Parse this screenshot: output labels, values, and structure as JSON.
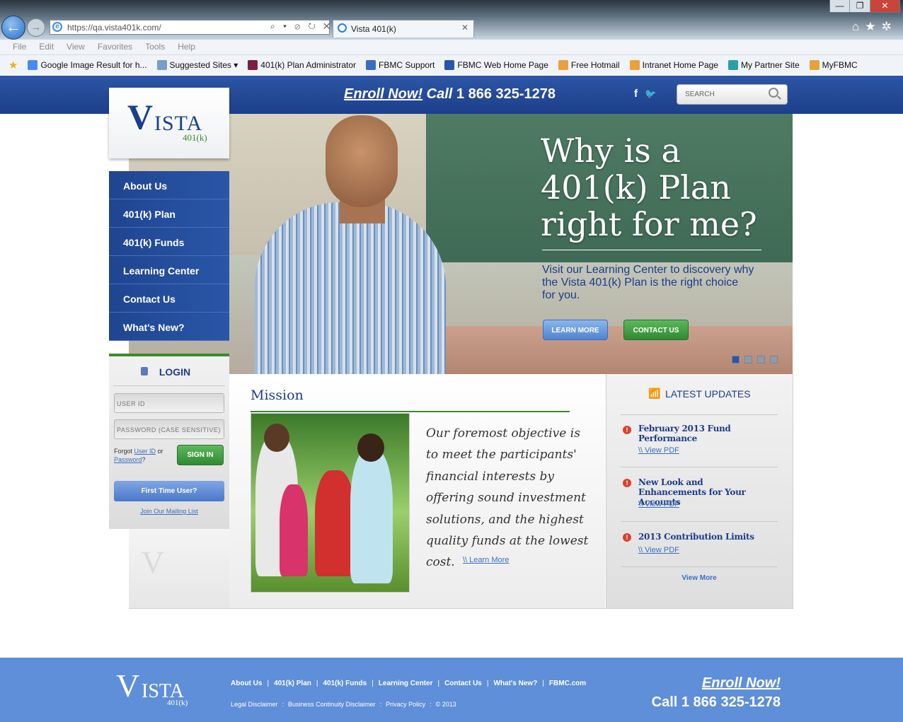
{
  "browser": {
    "url": "https://qa.vista401k.com/",
    "tab_title": "Vista 401(k)",
    "tab_close": "✕",
    "back_icon": "←",
    "forward_icon": "→",
    "addr_tools": "⌕ ▾ ⊘ ↻ ✕",
    "window_controls": [
      "—",
      "❐",
      "✕"
    ],
    "right_icons": "⌂★✲",
    "menu": [
      "File",
      "Edit",
      "View",
      "Favorites",
      "Tools",
      "Help"
    ],
    "favorites": [
      {
        "label": "Google Image Result for h...",
        "color": "#4a8af4"
      },
      {
        "label": "Suggested Sites ▾",
        "color": "#7a9dc9"
      },
      {
        "label": "401(k) Plan Administrator",
        "color": "#7a2040"
      },
      {
        "label": "FBMC Support",
        "color": "#3a6ec0"
      },
      {
        "label": "FBMC Web Home Page",
        "color": "#2a56a8"
      },
      {
        "label": "Free Hotmail",
        "color": "#e8a23c"
      },
      {
        "label": "Intranet Home Page",
        "color": "#e8a23c"
      },
      {
        "label": "My Partner Site",
        "color": "#2aa0a8"
      },
      {
        "label": "MyFBMC",
        "color": "#e8a23c"
      }
    ]
  },
  "header": {
    "enroll": "Enroll Now!",
    "call": "Call",
    "phone": "1 866 325-1278",
    "social_icons": "f",
    "twitter_glyph": "🐦",
    "search_placeholder": "SEARCH"
  },
  "logo": {
    "v": "V",
    "ista": "ISTA",
    "k": "401(k)"
  },
  "nav": [
    "About Us",
    "401(k) Plan",
    "401(k) Funds",
    "Learning Center",
    "Contact Us",
    "What's New?"
  ],
  "hero": {
    "title": "Why is a 401(k) Plan right for me?",
    "subtitle": "Visit our Learning Center to discovery why the Vista 401(k) Plan is the right choice for you.",
    "learn_more": "LEARN MORE",
    "contact_us": "CONTACT US",
    "slides": 4,
    "active_slide": 1
  },
  "login": {
    "title": "LOGIN",
    "user_id_placeholder": "USER ID",
    "password_placeholder": "PASSWORD (CASE SENSITIVE)",
    "forgot_prefix": "Forgot",
    "forgot_user_id": "User ID",
    "forgot_or": "or",
    "forgot_password": "Password",
    "forgot_suffix": "?",
    "sign_in": "SIGN IN",
    "first_time": "First Time User?",
    "mailing_list": "Join Our Mailing List"
  },
  "mission": {
    "title": "Mission",
    "text": "Our foremost objective is to meet the participants' financial interests by offering sound investment solutions, and the highest quality funds at the lowest cost.",
    "learn_more": "\\\\ Learn More"
  },
  "updates": {
    "title": "LATEST UPDATES",
    "items": [
      {
        "title": "February 2013 Fund Performance",
        "link": "\\\\ View PDF"
      },
      {
        "title": "New Look and Enhancements for Your Accounts",
        "link": "\\\\ View PDF"
      },
      {
        "title": "2013 Contribution Limits",
        "link": "\\\\ View PDF"
      }
    ],
    "view_more": "View More"
  },
  "footer": {
    "nav": [
      "About Us",
      "401(k) Plan",
      "401(k) Funds",
      "Learning Center",
      "Contact Us",
      "What's New?",
      "FBMC.com"
    ],
    "legal": [
      "Legal Disclaimer",
      "Business Continuity Disclaimer",
      "Privacy Policy",
      "© 2013"
    ],
    "enroll": "Enroll Now!",
    "call": "Call 1 866 325-1278"
  },
  "colors": {
    "brand_blue": "#1e3d86",
    "accent_green": "#3d8a2e",
    "footer_blue": "#5e8fd8"
  }
}
